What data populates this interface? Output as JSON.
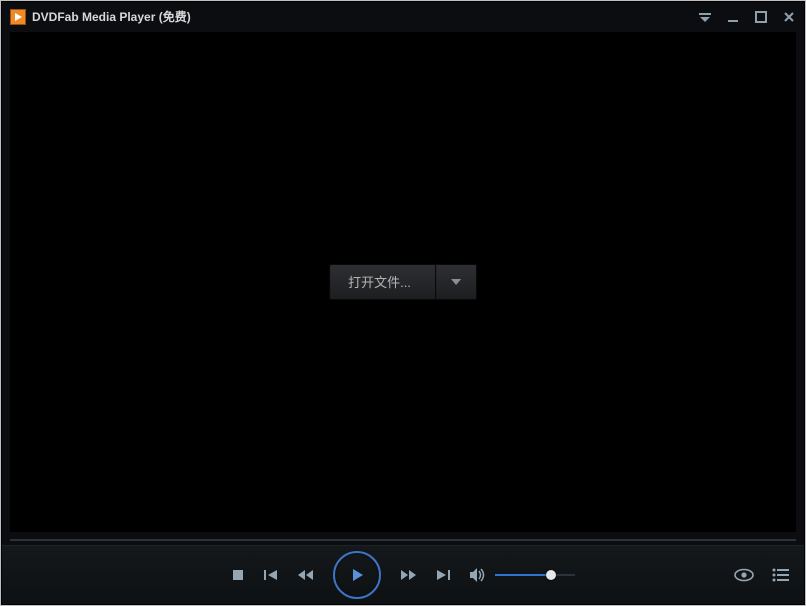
{
  "window": {
    "title": "DVDFab Media Player (免费)"
  },
  "open_button": {
    "label": "打开文件..."
  },
  "volume": {
    "percent": 70
  },
  "colors": {
    "accent": "#2f74d0",
    "logo_bg": "#f08a24"
  }
}
